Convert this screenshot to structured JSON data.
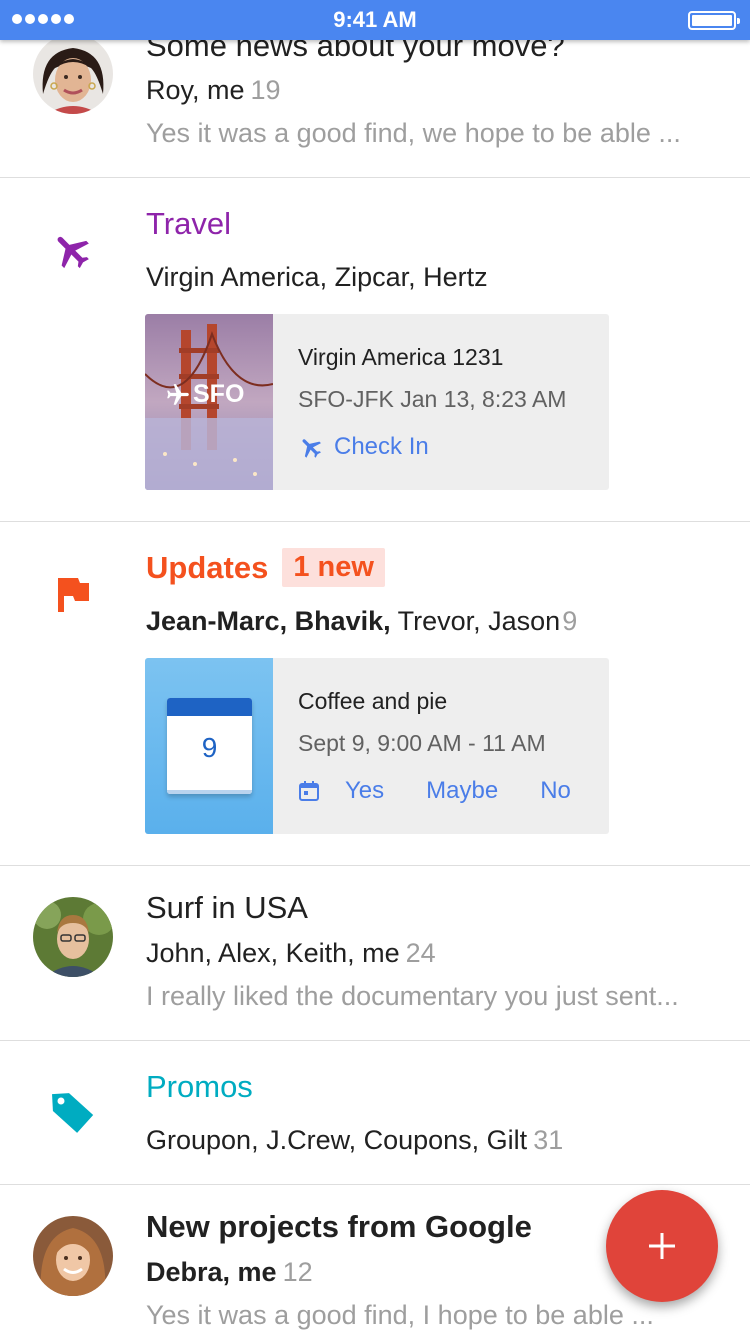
{
  "status_bar": {
    "time": "9:41 AM"
  },
  "threads": [
    {
      "subject": "Some news about your move?",
      "participants": "Roy, me",
      "count": "19",
      "snippet": "Yes it was a good find, we hope to be able ..."
    },
    {
      "subject": "Surf in USA",
      "participants": "John, Alex, Keith, me",
      "count": "24",
      "snippet": "I really liked the documentary you just sent..."
    },
    {
      "subject": "New projects from Google",
      "participants": "Debra, me",
      "count": "12",
      "snippet": "Yes it was a good find, I hope to be able ..."
    }
  ],
  "travel": {
    "label": "Travel",
    "senders": "Virgin America, Zipcar, Hertz",
    "card": {
      "image_label": "SFO",
      "title": "Virgin America 1231",
      "subtitle": "SFO-JFK Jan 13, 8:23 AM",
      "action": "Check In"
    }
  },
  "updates": {
    "label": "Updates",
    "badge": "1 new",
    "senders_bold": "Jean-Marc, Bhavik,",
    "senders": " Trevor, Jason",
    "count": "9",
    "card": {
      "calendar_day": "9",
      "title": "Coffee and pie",
      "subtitle": "Sept 9, 9:00 AM - 11 AM",
      "rsvp": [
        "Yes",
        "Maybe",
        "No"
      ]
    }
  },
  "promos": {
    "label": "Promos",
    "senders": "Groupon, J.Crew, Coupons, Gilt",
    "count": "31"
  },
  "colors": {
    "status_bar": "#4a86f0",
    "travel": "#8e24aa",
    "updates": "#f4511e",
    "promos": "#00acc1",
    "fab": "#e0443a",
    "link": "#4a7de8"
  },
  "icons": {
    "travel": "airplane-icon",
    "updates": "flag-icon",
    "promos": "tag-icon",
    "fab": "plus-icon"
  }
}
